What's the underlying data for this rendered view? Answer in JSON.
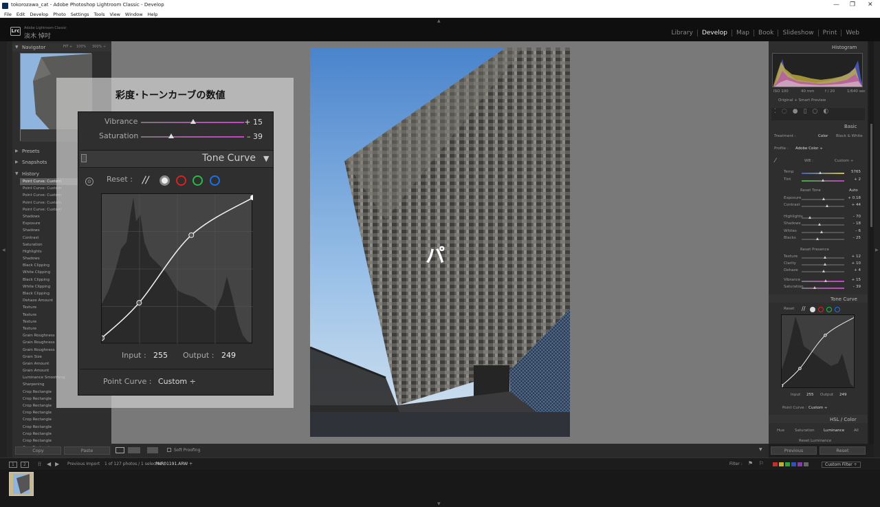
{
  "window": {
    "title": "tokorozawa_cat - Adobe Photoshop Lightroom Classic - Develop",
    "controls": [
      "—",
      "❐",
      "✕"
    ]
  },
  "menu": [
    "File",
    "Edit",
    "Develop",
    "Photo",
    "Settings",
    "Tools",
    "View",
    "Window",
    "Help"
  ],
  "brand": {
    "logo": "Lrc",
    "line1": "Adobe Lightroom Classic",
    "identity": "淡木 悼吋"
  },
  "modules": [
    "Library",
    "Develop",
    "Map",
    "Book",
    "Slideshow",
    "Print",
    "Web"
  ],
  "active_module": "Develop",
  "left": {
    "navigator": {
      "title": "Navigator",
      "zoom": [
        "FIT ÷",
        "100%",
        "300% ÷"
      ]
    },
    "presets": "Presets",
    "snapshots": "Snapshots",
    "history_title": "History",
    "history": [
      "Point Curve: Custom",
      "Point Curve: Custom",
      "Point Curve: Custom",
      "Point Curve: Custom",
      "Point Curve: Custom",
      "Shadows",
      "Exposure",
      "Shadows",
      "Contrast",
      "Saturation",
      "Highlights",
      "Shadows",
      "Black Clipping",
      "White Clipping",
      "Black Clipping",
      "White Clipping",
      "Black Clipping",
      "Dehaze Amount",
      "Texture",
      "Texture",
      "Texture",
      "Texture",
      "Grain Roughness",
      "Grain Roughness",
      "Grain Roughness",
      "Grain Size",
      "Grain Amount",
      "Grain Amount",
      "Luminance Smoothing",
      "Sharpening",
      "Crop Rectangle",
      "Crop Rectangle",
      "Crop Rectangle",
      "Crop Rectangle",
      "Crop Rectangle",
      "Crop Rectangle",
      "Crop Rectangle",
      "Crop Rectangle",
      "Crop Rectangle"
    ],
    "copy": "Copy",
    "paste": "Paste"
  },
  "overlay": {
    "title": "彩度･トーンカーブの数値",
    "vibrance": {
      "label": "Vibrance",
      "value": "+ 15"
    },
    "saturation": {
      "label": "Saturation",
      "value": "– 39"
    },
    "tone_curve_title": "Tone Curve",
    "reset": "Reset :",
    "input_label": "Input :",
    "input_value": "255",
    "output_label": "Output :",
    "output_value": "249",
    "point_curve_label": "Point Curve :",
    "point_curve_value": "Custom ÷",
    "curve_points": [
      [
        0,
        10
      ],
      [
        63,
        70
      ],
      [
        151,
        185
      ],
      [
        255,
        249
      ]
    ]
  },
  "right": {
    "histogram": "Histogram",
    "exif": [
      "ISO 100",
      "40 mm",
      "f / 20",
      "1/640 sec"
    ],
    "preview": "Original + Smart Preview",
    "basic": "Basic",
    "treatment": "Treatment :",
    "color": "Color",
    "bw": "Black & White",
    "profile_label": "Profile :",
    "profile": "Adobe Color ÷",
    "wb_label": "WB :",
    "wb": "Custom ÷",
    "temp": {
      "label": "Temp",
      "value": "5765"
    },
    "tint": {
      "label": "Tint",
      "value": "+ 2"
    },
    "tone": "Reset Tone",
    "auto": "Auto",
    "exposure": {
      "label": "Exposure",
      "value": "+ 0.18"
    },
    "contrast": {
      "label": "Contrast",
      "value": "+ 44"
    },
    "highlights": {
      "label": "Highlights",
      "value": "– 70"
    },
    "shadows": {
      "label": "Shadows",
      "value": "– 18"
    },
    "whites": {
      "label": "Whites",
      "value": "– 6"
    },
    "blacks": {
      "label": "Blacks",
      "value": "– 25"
    },
    "presence": "Reset Presence",
    "texture": {
      "label": "Texture",
      "value": "+ 12"
    },
    "clarity": {
      "label": "Clarity",
      "value": "+ 10"
    },
    "dehaze": {
      "label": "Dehaze",
      "value": "+ 4"
    },
    "vibrance": {
      "label": "Vibrance",
      "value": "+ 15"
    },
    "saturation": {
      "label": "Saturation",
      "value": "– 39"
    },
    "tone_curve": "Tone Curve",
    "reset": "Reset",
    "input_label": "Input",
    "input_value": "255",
    "output_label": "Output",
    "output_value": "249",
    "point_curve": "Point Curve :",
    "point_curve_value": "Custom ÷",
    "hsl": "HSL / Color",
    "hsl_tabs": [
      "Hue",
      "Saturation",
      "Luminance",
      "All"
    ],
    "luminance_reset": "Reset Luminance",
    "previous": "Previous",
    "reset_btn": "Reset"
  },
  "toolbar": {
    "soft_proofing": "Soft Proofing"
  },
  "filmbar": {
    "pages": [
      "1",
      "2"
    ],
    "source": "Previous Import",
    "count": "1 of 127 photos / 1 selected /",
    "file": "PNR01191.ARW ÷",
    "filter": "Filter :",
    "custom_filter": "Custom Filter ÷"
  },
  "colors": {
    "accent": "#ffffff",
    "panel": "#2e2e2e",
    "red": "#e02020",
    "green": "#20c040",
    "blue": "#2070e0"
  }
}
